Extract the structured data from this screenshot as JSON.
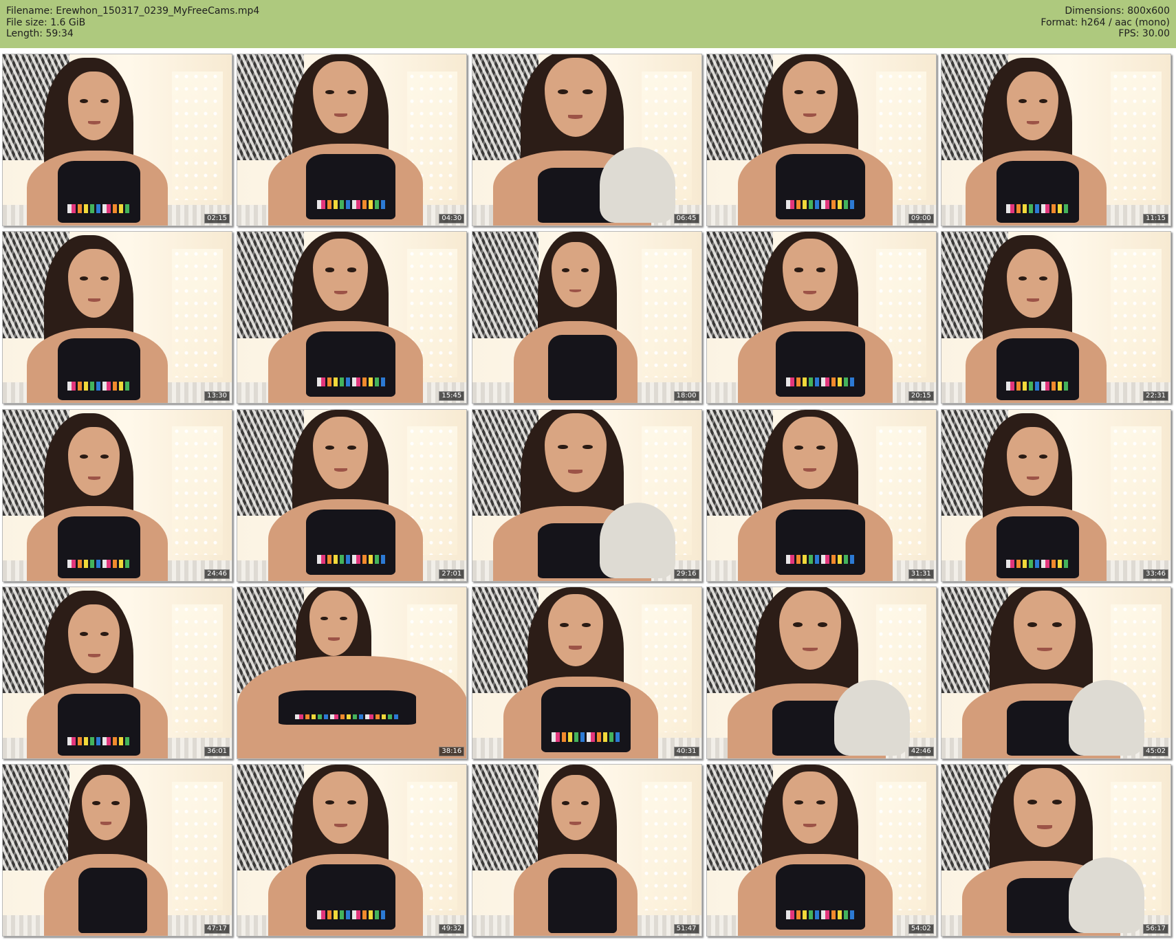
{
  "header": {
    "filename": "Filename: Erewhon_150317_0239_MyFreeCams.mp4",
    "file_size": "File size: 1.6 GiB",
    "length": "Length: 59:34",
    "dimensions": "Dimensions: 800x600",
    "format": "Format: h264 / aac (mono)",
    "fps": "FPS: 30.00"
  },
  "colors": {
    "header_background": "#aec97e",
    "page_background": "#ffffff",
    "timestamp_background": "#191919"
  },
  "thumbnails": [
    {
      "timestamp": "02:15",
      "variant": 0
    },
    {
      "timestamp": "04:30",
      "variant": 1
    },
    {
      "timestamp": "06:45",
      "variant": 2
    },
    {
      "timestamp": "09:00",
      "variant": 1
    },
    {
      "timestamp": "11:15",
      "variant": 0
    },
    {
      "timestamp": "13:30",
      "variant": 0
    },
    {
      "timestamp": "15:45",
      "variant": 1
    },
    {
      "timestamp": "18:00",
      "variant": 3
    },
    {
      "timestamp": "20:15",
      "variant": 1
    },
    {
      "timestamp": "22:31",
      "variant": 0
    },
    {
      "timestamp": "24:46",
      "variant": 0
    },
    {
      "timestamp": "27:01",
      "variant": 1
    },
    {
      "timestamp": "29:16",
      "variant": 2
    },
    {
      "timestamp": "31:31",
      "variant": 1
    },
    {
      "timestamp": "33:46",
      "variant": 0
    },
    {
      "timestamp": "36:01",
      "variant": 0
    },
    {
      "timestamp": "38:16",
      "variant": 4
    },
    {
      "timestamp": "40:31",
      "variant": 1
    },
    {
      "timestamp": "42:46",
      "variant": 2
    },
    {
      "timestamp": "45:02",
      "variant": 2
    },
    {
      "timestamp": "47:17",
      "variant": 3
    },
    {
      "timestamp": "49:32",
      "variant": 1
    },
    {
      "timestamp": "51:47",
      "variant": 3
    },
    {
      "timestamp": "54:02",
      "variant": 1
    },
    {
      "timestamp": "56:17",
      "variant": 2
    }
  ]
}
